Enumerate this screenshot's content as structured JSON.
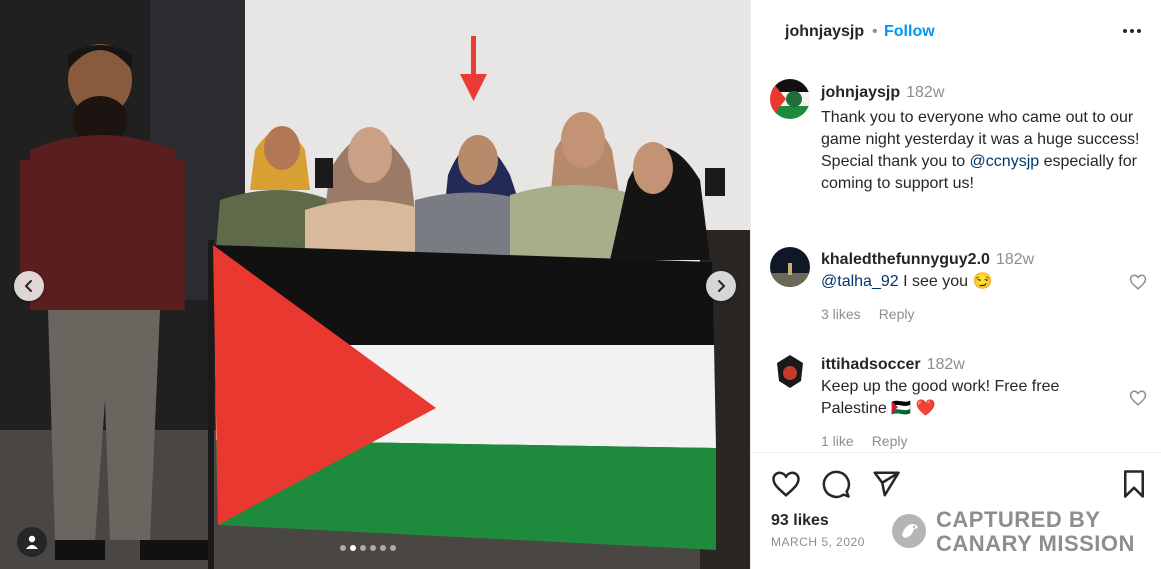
{
  "post": {
    "username": "johnjaysjp",
    "separator": "•",
    "follow_label": "Follow",
    "time": "182w",
    "caption_line1": "Thank you to everyone who came out to our game night yesterday it was a huge success! Special thank you to ",
    "caption_mention": "@ccnysjp",
    "caption_line2": " especially for coming to support us!"
  },
  "comments": [
    {
      "username": "khaledthefunnyguy2.0",
      "time": "182w",
      "mention": "@talha_92",
      "text": " I see you 😏",
      "likes": "3 likes",
      "reply": "Reply"
    },
    {
      "username": "ittihadsoccer",
      "time": "182w",
      "text": "Keep up the good work! Free free Palestine 🇵🇸 ❤️",
      "likes": "1 like",
      "reply": "Reply"
    }
  ],
  "footer": {
    "likes": "93 likes",
    "date": "MARCH 5, 2020"
  },
  "watermark": {
    "line1": "CAPTURED BY",
    "line2": "CANARY MISSION"
  },
  "carousel": {
    "slide_count": 6,
    "active_index": 1
  },
  "colors": {
    "follow": "#0095f6",
    "mention": "#00376b",
    "arrow": "#ec3b36",
    "flag_black": "#111111",
    "flag_white": "#f2f2f2",
    "flag_green": "#1e8a3c",
    "flag_red": "#e8382f"
  },
  "icons": [
    "more-icon",
    "heart-icon",
    "comment-icon",
    "share-icon",
    "bookmark-icon",
    "chevron-left-icon",
    "chevron-right-icon",
    "user-tag-icon",
    "canary-logo-icon"
  ]
}
